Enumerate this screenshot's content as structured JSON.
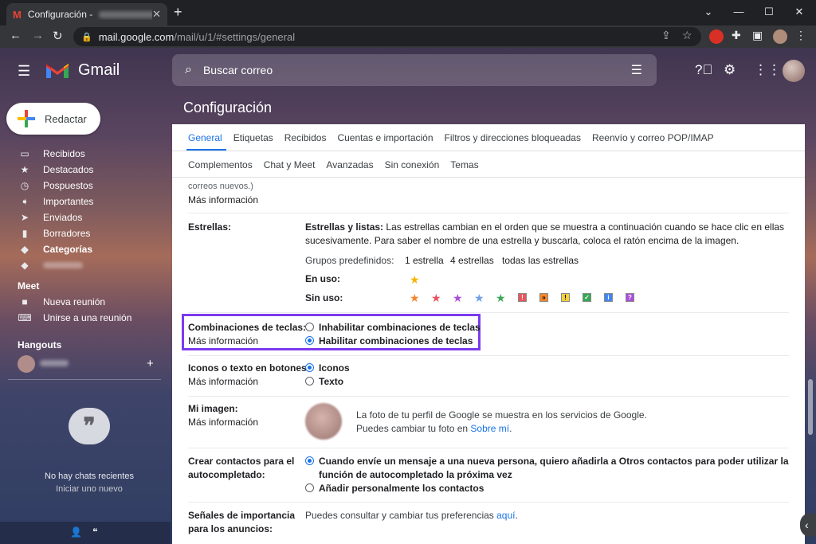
{
  "browser": {
    "tab_title": "Configuración - ",
    "tab_favicon": "M",
    "new_tab": "+",
    "url_host": "mail.google.com",
    "url_path": "/mail/u/1/#settings/general"
  },
  "gmail": {
    "product_name": "Gmail",
    "search_placeholder": "Buscar correo",
    "compose_label": "Redactar"
  },
  "sidebar": {
    "items": [
      {
        "label": "Recibidos",
        "icon": "inbox-icon"
      },
      {
        "label": "Destacados",
        "icon": "star-icon"
      },
      {
        "label": "Pospuestos",
        "icon": "clock-icon"
      },
      {
        "label": "Importantes",
        "icon": "label-important-icon"
      },
      {
        "label": "Enviados",
        "icon": "send-icon"
      },
      {
        "label": "Borradores",
        "icon": "draft-icon"
      },
      {
        "label": "Categorías",
        "icon": "label-icon"
      }
    ],
    "meet_heading": "Meet",
    "meet_items": [
      {
        "label": "Nueva reunión",
        "icon": "video-icon"
      },
      {
        "label": "Unirse a una reunión",
        "icon": "keyboard-icon"
      }
    ],
    "hangouts_heading": "Hangouts",
    "no_chats": "No hay chats recientes",
    "start_new": "Iniciar uno nuevo"
  },
  "settings": {
    "title": "Configuración",
    "tabs_row1": [
      "General",
      "Etiquetas",
      "Recibidos",
      "Cuentas e importación",
      "Filtros y direcciones bloqueadas",
      "Reenvío y correo POP/IMAP"
    ],
    "tabs_row2": [
      "Complementos",
      "Chat y Meet",
      "Avanzadas",
      "Sin conexión",
      "Temas"
    ],
    "more_info": "Más información",
    "partial_text": "correos nuevos.)",
    "stars": {
      "label": "Estrellas:",
      "desc_bold": "Estrellas y listas:",
      "desc_line1": " Las estrellas cambian en el orden que se muestra a continuación cuando se hace clic en ellas",
      "desc_line2": "sucesivamente. Para saber el nombre de una estrella y buscarla, coloca el ratón encima de la imagen.",
      "presets_label": "Grupos predefinidos:",
      "presets": [
        "1 estrella",
        "4 estrellas",
        "todas las estrellas"
      ],
      "in_use": "En uso:",
      "not_in_use": "Sin uso:"
    },
    "shortcuts": {
      "label": "Combinaciones de teclas:",
      "options": [
        "Inhabilitar combinaciones de teclas",
        "Habilitar combinaciones de teclas"
      ],
      "selected": 1
    },
    "button_labels": {
      "label": "Iconos o texto en botones:",
      "options": [
        "Iconos",
        "Texto"
      ],
      "selected": 0
    },
    "my_picture": {
      "label": "Mi imagen:",
      "line1": "La foto de tu perfil de Google se muestra en los servicios de Google.",
      "line2_prefix": "Puedes cambiar tu foto en ",
      "line2_link": "Sobre mí",
      "line2_suffix": "."
    },
    "auto_contacts": {
      "label_line1": "Crear contactos para el",
      "label_line2": "autocompletado:",
      "opt1_line1": "Cuando envíe un mensaje a una nueva persona, quiero añadirla a Otros contactos para poder utilizar la",
      "opt1_line2": "función de autocompletado la próxima vez",
      "opt2": "Añadir personalmente los contactos",
      "selected": 0
    },
    "ad_signals": {
      "label_line1": "Señales de importancia",
      "label_line2": "para los anuncios:",
      "text_prefix": "Puedes consultar y cambiar tus preferencias ",
      "text_link": "aquí",
      "text_suffix": "."
    }
  },
  "colors": {
    "accent": "#1a73e8",
    "highlight_box": "#7c3aed",
    "star_yellow": "#f4b400",
    "star_orange": "#f6852a",
    "star_red": "#e8555e",
    "star_purple": "#a94fdb",
    "star_blue": "#6fa0e8",
    "star_green": "#3aa757"
  }
}
